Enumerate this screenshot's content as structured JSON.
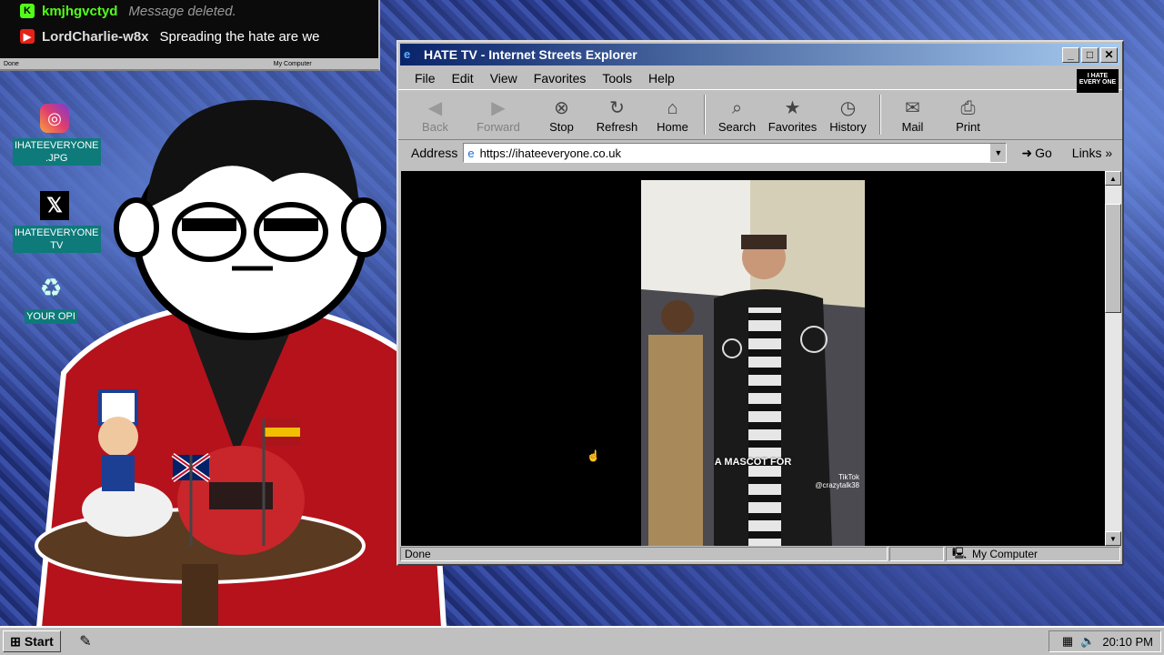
{
  "chat": {
    "messages": [
      {
        "platform_icon": "kick-icon",
        "badge": "K",
        "user": "kmjhgvctyd",
        "text": "Message deleted.",
        "user_color": "#53fc18",
        "text_color": "#999999"
      },
      {
        "platform_icon": "youtube-icon",
        "badge": "▶",
        "user": "LordCharlie-w8x",
        "text": "Spreading the hate are we",
        "user_color": "#dddddd",
        "text_color": "#ffffff"
      }
    ],
    "status_left": "Done",
    "status_right": "My Computer"
  },
  "desktop_icons": [
    {
      "icon": "instagram-icon",
      "glyph": "◎",
      "label_line1": "IHATEEVERYONE",
      "label_line2": ".JPG"
    },
    {
      "icon": "x-logo-icon",
      "glyph": "𝕏",
      "label_line1": "IHATEEVERYONE",
      "label_line2": "TV"
    },
    {
      "icon": "recycle-bin-icon",
      "glyph": "♻",
      "label_line1": "YOUR OPI",
      "label_line2": ""
    }
  ],
  "window": {
    "title": "HATE TV - Internet Streets Explorer",
    "menu": [
      "File",
      "Edit",
      "View",
      "Favorites",
      "Tools",
      "Help"
    ],
    "brand_logo": "I HATE EVERY ONE",
    "toolbar": [
      {
        "label": "Back",
        "icon": "back-arrow-icon",
        "glyph": "◀",
        "disabled": true
      },
      {
        "label": "Forward",
        "icon": "forward-arrow-icon",
        "glyph": "▶",
        "disabled": true
      },
      {
        "label": "Stop",
        "icon": "stop-icon",
        "glyph": "⊗",
        "disabled": false
      },
      {
        "label": "Refresh",
        "icon": "refresh-icon",
        "glyph": "↻",
        "disabled": false
      },
      {
        "label": "Home",
        "icon": "home-icon",
        "glyph": "⌂",
        "disabled": false
      },
      {
        "label": "Search",
        "icon": "search-icon",
        "glyph": "⌕",
        "disabled": false
      },
      {
        "label": "Favorites",
        "icon": "favorites-icon",
        "glyph": "★",
        "disabled": false
      },
      {
        "label": "History",
        "icon": "history-icon",
        "glyph": "◷",
        "disabled": false
      },
      {
        "label": "Mail",
        "icon": "mail-icon",
        "glyph": "✉",
        "disabled": false
      },
      {
        "label": "Print",
        "icon": "print-icon",
        "glyph": "⎙",
        "disabled": false
      }
    ],
    "address_label": "Address",
    "address_url": "https://ihateeveryone.co.uk",
    "go_label": "Go",
    "links_label": "Links",
    "video_caption": "A MASCOT FOR",
    "video_watermark_line1": "TikTok",
    "video_watermark_line2": "@crazytalk38",
    "status_text": "Done",
    "status_zone": "My Computer"
  },
  "taskbar": {
    "start_label": "Start",
    "clock": "20:10 PM"
  }
}
